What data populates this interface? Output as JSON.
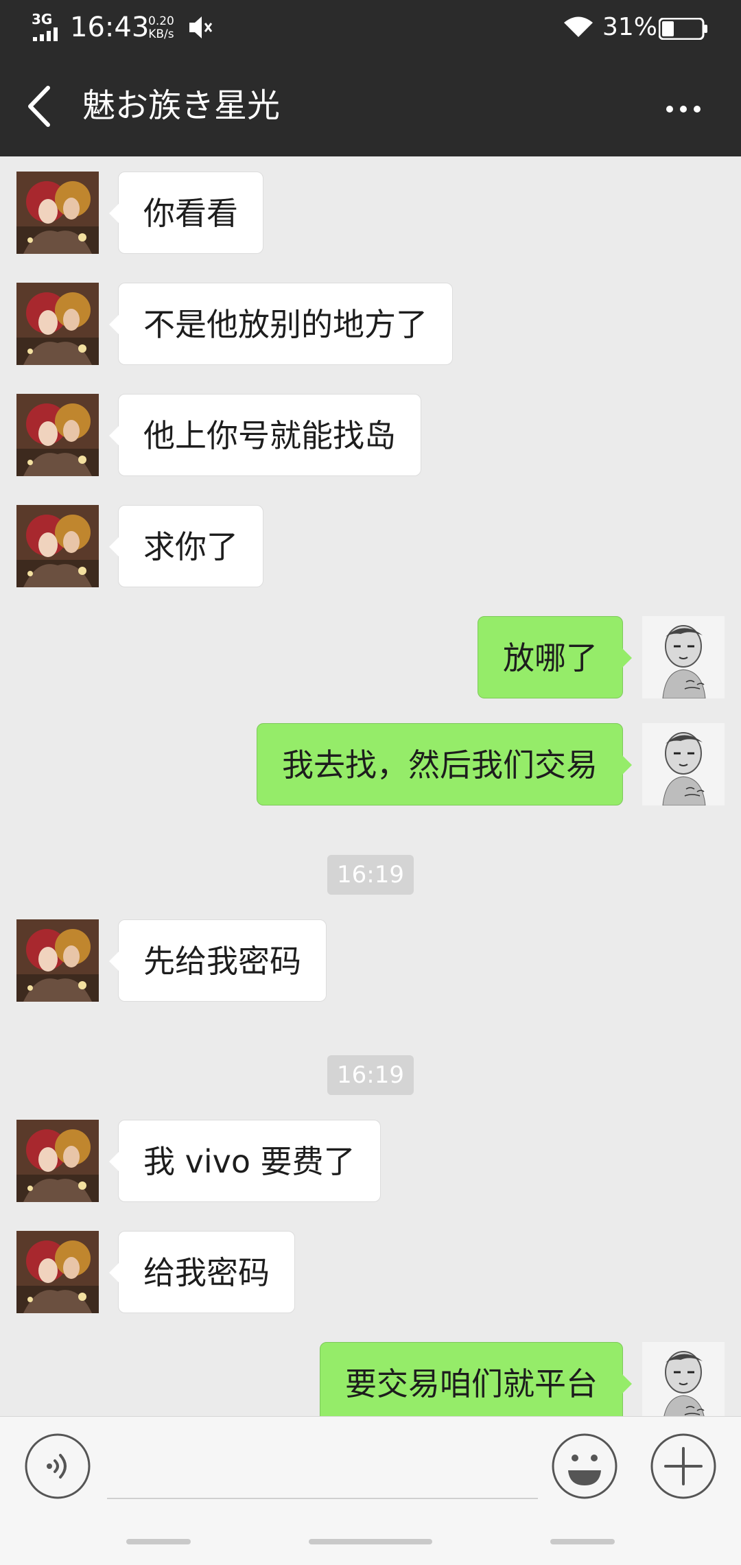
{
  "status_bar": {
    "network": "3G",
    "time": "16:43",
    "speed_value": "0.20",
    "speed_unit": "KB/s",
    "battery_percent": "31%",
    "battery_level": 0.31
  },
  "header": {
    "title": "魅お族き星光",
    "back_icon": "chevron-left-icon",
    "more_icon": "more-dots-icon"
  },
  "messages": [
    {
      "from": "them",
      "text": "你看看"
    },
    {
      "from": "them",
      "text": "不是他放别的地方了"
    },
    {
      "from": "them",
      "text": "他上你号就能找岛"
    },
    {
      "from": "them",
      "text": "求你了"
    },
    {
      "from": "me",
      "text": "放哪了"
    },
    {
      "from": "me",
      "text": "我去找，然后我们交易"
    },
    {
      "time": "16:19"
    },
    {
      "from": "them",
      "text": "先给我密码"
    },
    {
      "time": "16:19"
    },
    {
      "from": "them",
      "text": "我 vivo 要费了"
    },
    {
      "from": "them",
      "text": "给我密码"
    },
    {
      "from": "me",
      "text": "要交易咱们就平台"
    }
  ],
  "input_bar": {
    "voice_icon": "voice-icon",
    "emoji_icon": "emoji-icon",
    "plus_icon": "plus-icon",
    "placeholder": ""
  },
  "colors": {
    "header_bg": "#2b2b2b",
    "chat_bg": "#ebebeb",
    "incoming_bubble": "#ffffff",
    "outgoing_bubble": "#95ec69",
    "timestamp_bg": "#d4d4d4"
  }
}
